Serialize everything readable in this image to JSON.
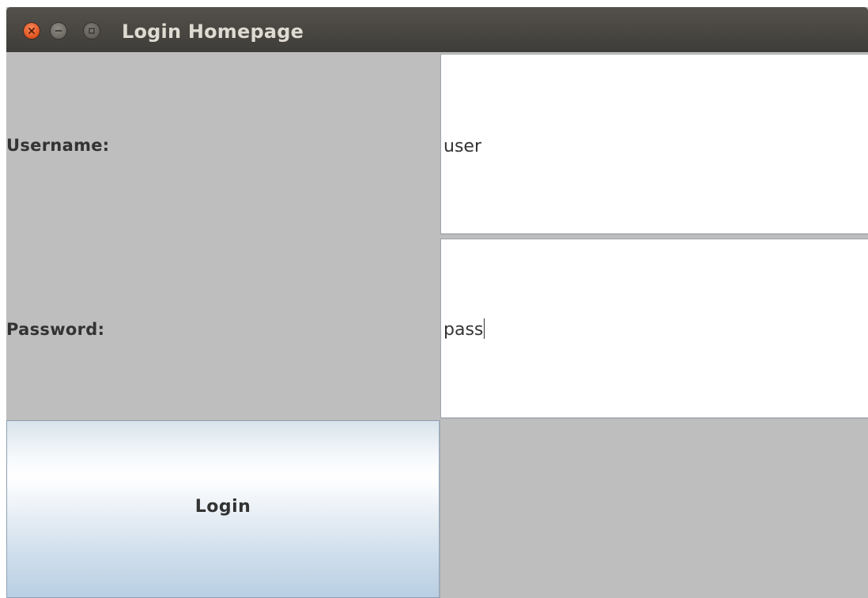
{
  "window": {
    "title": "Login Homepage",
    "controls": {
      "close": "close-icon",
      "minimize": "minimize-icon",
      "maximize": "maximize-icon"
    }
  },
  "form": {
    "username": {
      "label": "Username:",
      "value": "user"
    },
    "password": {
      "label": "Password:",
      "value": "pass",
      "focused": true
    },
    "login_label": "Login"
  },
  "colors": {
    "titlebar": "#4b4843",
    "panel": "#bebebe",
    "close_button": "#e9592a",
    "button_gradient_bottom": "#b9cfe3"
  }
}
